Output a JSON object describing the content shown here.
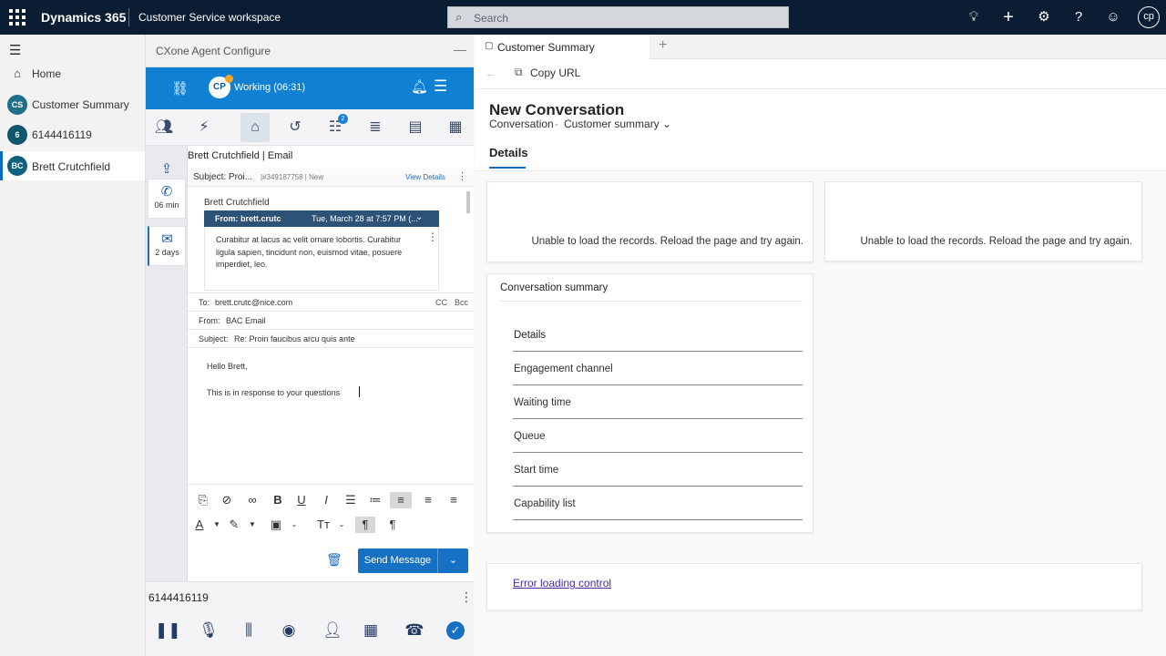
{
  "topbar": {
    "app_name": "Dynamics 365",
    "workspace_name": "Customer Service workspace",
    "search_placeholder": "Search",
    "avatar_initials": "cp"
  },
  "sitemap": {
    "items": [
      {
        "label": "Home",
        "icon": "home-icon"
      },
      {
        "label": "Customer Summary",
        "initials": "CS",
        "color": "#1f6f8b"
      },
      {
        "label": "6144416119",
        "initials": "6",
        "color": "#10576e"
      },
      {
        "label": "Brett Crutchfield",
        "initials": "BC",
        "color": "#0f6180",
        "selected": true
      }
    ]
  },
  "cxone": {
    "title": "CXone Agent Configure",
    "agent_initials": "CP",
    "status": "Working (06:31)",
    "rail": [
      {
        "icon": "phone-icon",
        "label": "06 min"
      },
      {
        "icon": "mail-icon",
        "label": "2 days"
      }
    ],
    "tool_badge": "2",
    "email": {
      "title": "Brett Crutchfield | Email",
      "subject_label": "Subject: Proi...",
      "meta": "|#349187758 | New",
      "view_details": "View Details",
      "sender": "Brett Crutchfield",
      "from_short": "From: brett.crutc",
      "date": "Tue, March 28 at 7:57 PM (...",
      "body": "Curabitur at lacus ac velit ornare lobortis. Curabitur ligula sapien, tincidunt non, euismod vitae, posuere imperdiet, leo.",
      "to_label": "To:",
      "to_value": "brett.crutc@nice.com",
      "cc": "CC",
      "bcc": "Bcc",
      "from_label": "From:",
      "from_value": "BAC Email",
      "reply_subject_label": "Subject:",
      "reply_subject_value": "Re: Proin faucibus arcu quis ante",
      "compose_line1": "Hello Brett,",
      "compose_line2": "This is in response to your questions",
      "send_label": "Send Message"
    },
    "call": {
      "number": "6144416119"
    }
  },
  "session": {
    "tab_label": "Customer Summary",
    "copy_url": "Copy URL",
    "form_title": "New Conversation",
    "entity": "Conversation",
    "form_name": "Customer summary",
    "active_tab": "Details",
    "error_text_1": "Unable to load the records. Reload the page and try again.",
    "error_text_2": "Unable to load the records. Reload the page and try again.",
    "summary": {
      "title": "Conversation summary",
      "header": "Details",
      "rows": [
        "Engagement channel",
        "Waiting time",
        "Queue",
        "Start time",
        "Capability list"
      ]
    },
    "error_link": "Error loading control"
  }
}
